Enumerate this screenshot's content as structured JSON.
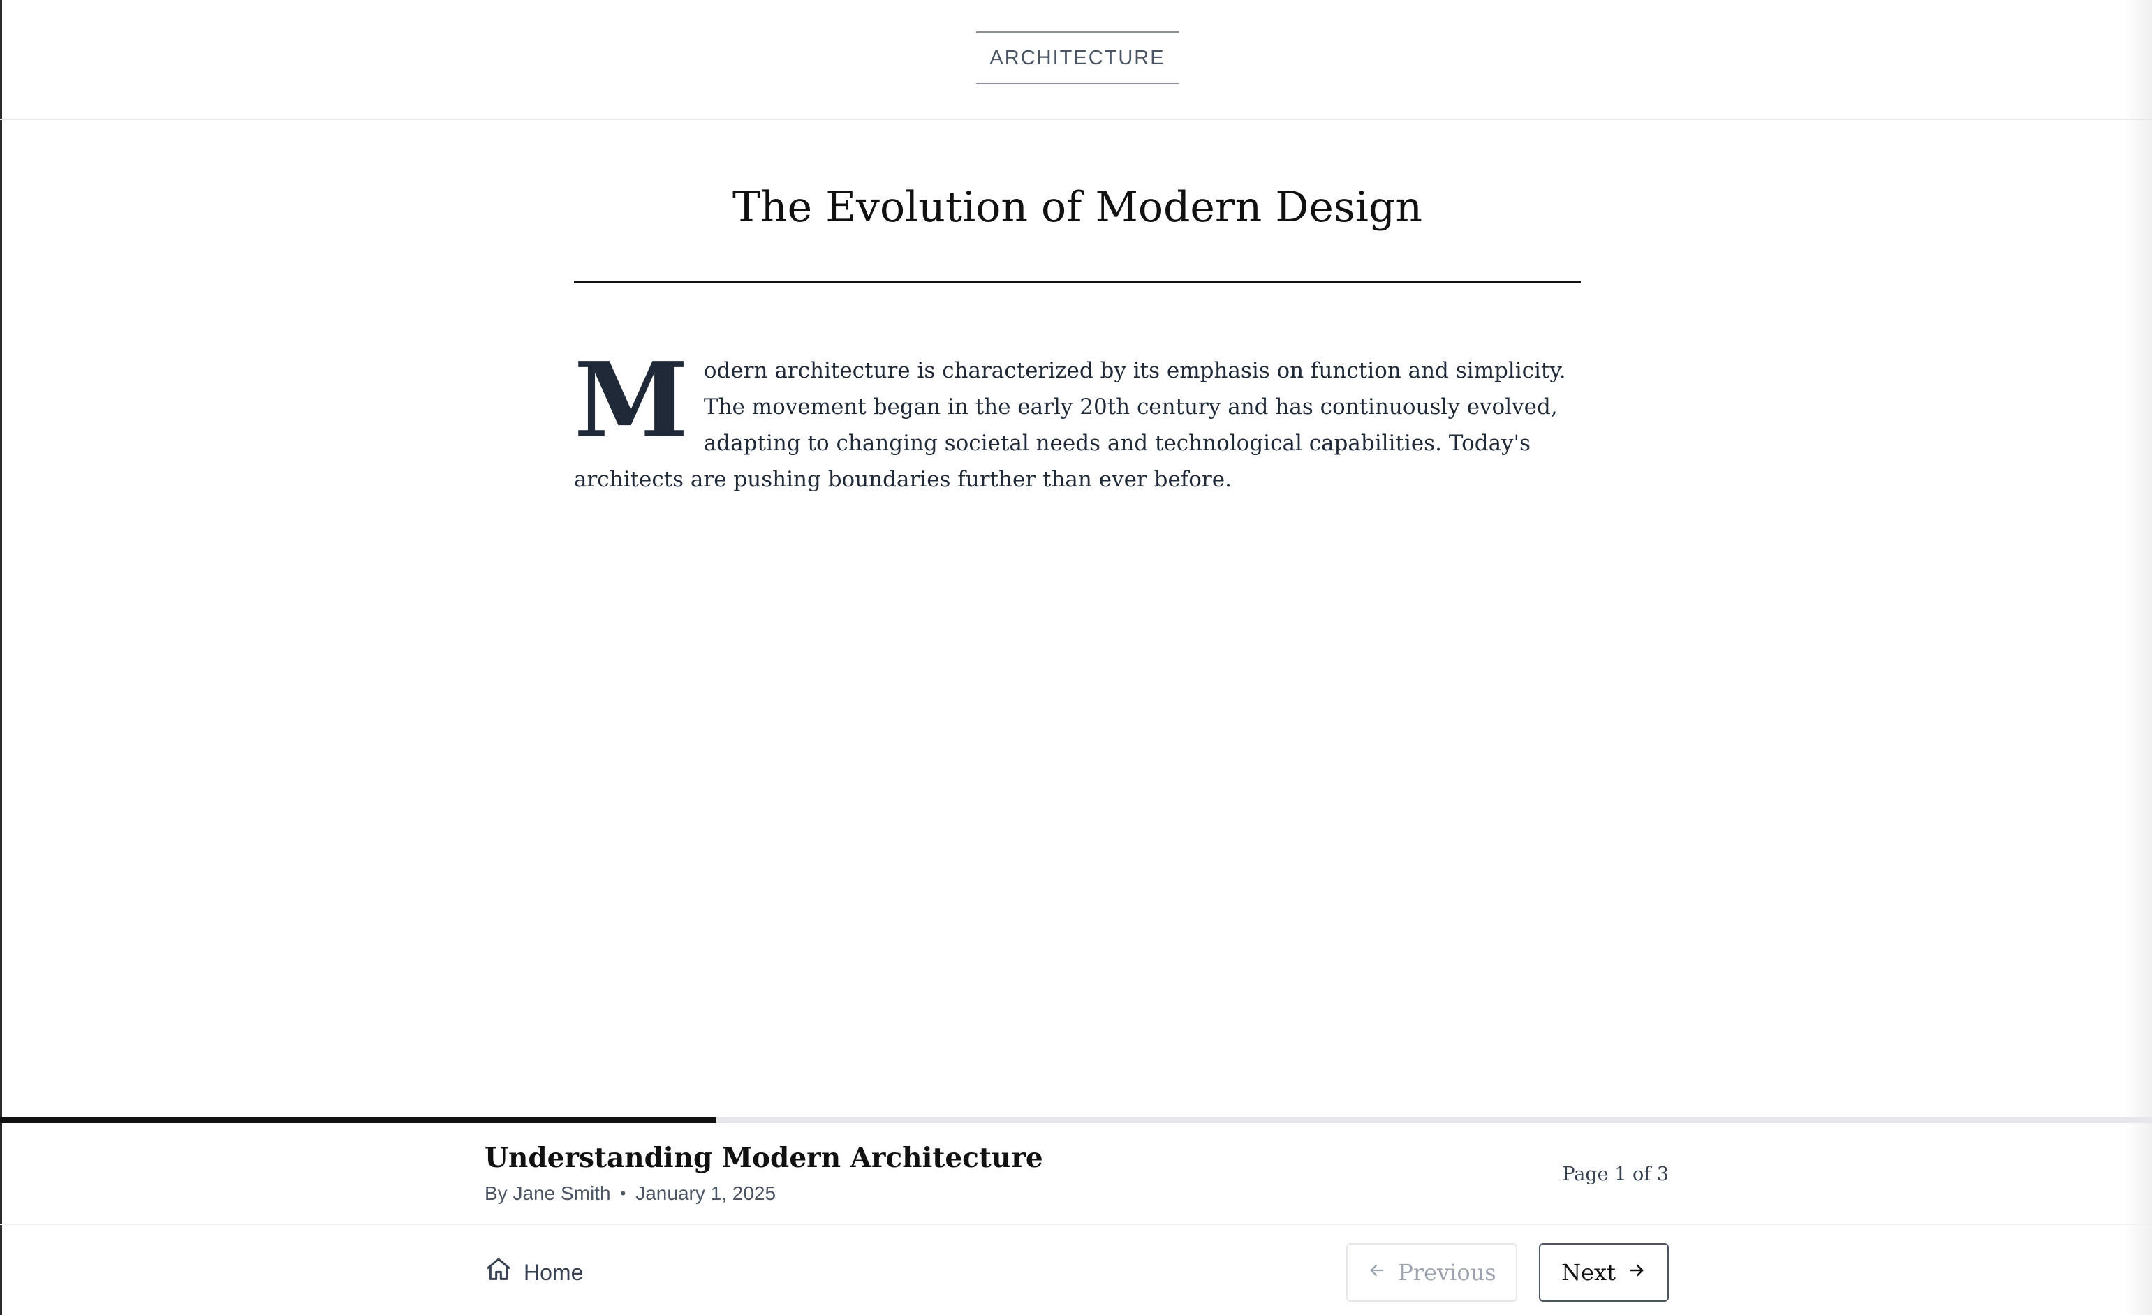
{
  "header": {
    "category": "ARCHITECTURE"
  },
  "article": {
    "title": "The Evolution of Modern Design",
    "dropcap": "M",
    "body": "odern architecture is characterized by its emphasis on function and simplicity. The movement began in the early 20th century and has continuously evolved, adapting to changing societal needs and technological capabilities. Today's architects are pushing boundaries further than ever before."
  },
  "progress": {
    "fraction": 0.333
  },
  "footer": {
    "book_title": "Understanding Modern Architecture",
    "author": "By Jane Smith",
    "separator": "•",
    "date": "January 1, 2025",
    "page_indicator": "Page 1 of 3"
  },
  "nav": {
    "home_label": "Home",
    "home_icon": "home-icon",
    "previous_label": "Previous",
    "previous_icon": "arrow-left-icon",
    "previous_disabled": true,
    "next_label": "Next",
    "next_icon": "arrow-right-icon"
  },
  "colors": {
    "text": "#1f2937",
    "accent": "#111111",
    "muted": "#9ca3af",
    "progress_track": "#e5e7eb"
  }
}
